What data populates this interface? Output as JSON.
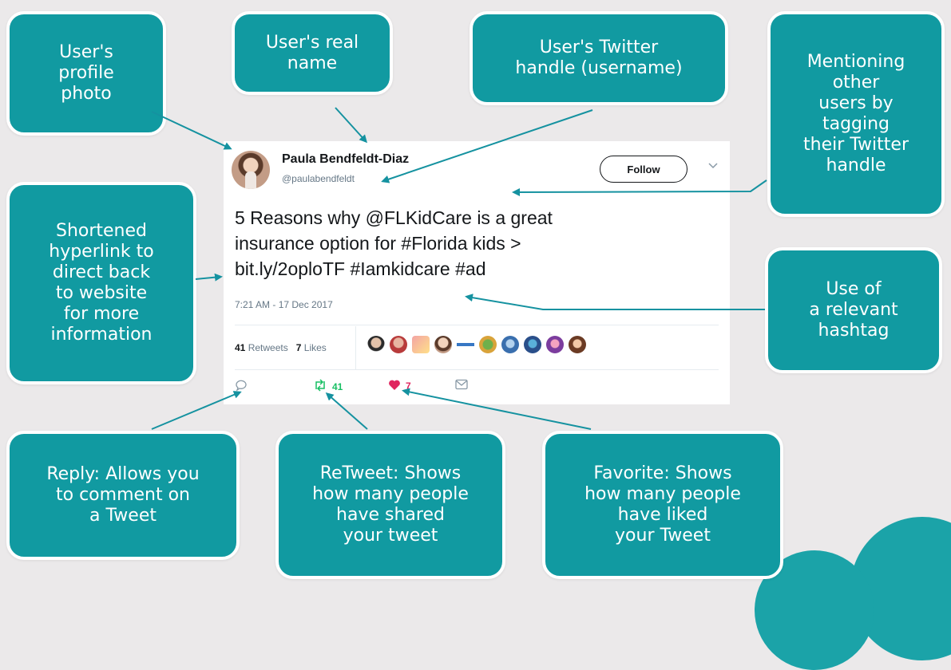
{
  "callouts": {
    "profile_photo": "User's\nprofile\nphoto",
    "real_name": "User's real\nname",
    "twitter_handle": "User's Twitter\nhandle (username)",
    "mentioning": "Mentioning\nother\nusers by\ntagging\ntheir Twitter\nhandle",
    "shortened_link": "Shortened\nhyperlink to\ndirect back\nto website\nfor more\ninformation",
    "hashtag": "Use of\na relevant\nhashtag",
    "reply": "Reply: Allows you\nto comment on\na Tweet",
    "retweet": "ReTweet: Shows\nhow many people\nhave shared\nyour tweet",
    "favorite": "Favorite: Shows\nhow many people\nhave liked\nyour Tweet"
  },
  "tweet": {
    "name": "Paula Bendfeldt-Diaz",
    "handle": "@paulabendfeldt",
    "follow_label": "Follow",
    "text_line1": "5 Reasons why @FLKidCare is a great",
    "text_line2": "insurance option for #Florida kids >",
    "text_line3": "bit.ly/2oploTF  #Iamkidcare #ad",
    "timestamp": "7:21 AM - 17 Dec 2017",
    "retweets_count": "41",
    "retweets_label": "Retweets",
    "likes_count": "7",
    "likes_label": "Likes",
    "retweet_action_count": "41",
    "like_action_count": "7"
  },
  "colors": {
    "callout_bg": "#119aa1",
    "arrow": "#1592a0",
    "retweet_green": "#17bf63",
    "like_red": "#e0245e"
  },
  "icons": [
    "reply-icon",
    "retweet-icon",
    "heart-icon",
    "message-icon",
    "chevron-down-icon"
  ]
}
